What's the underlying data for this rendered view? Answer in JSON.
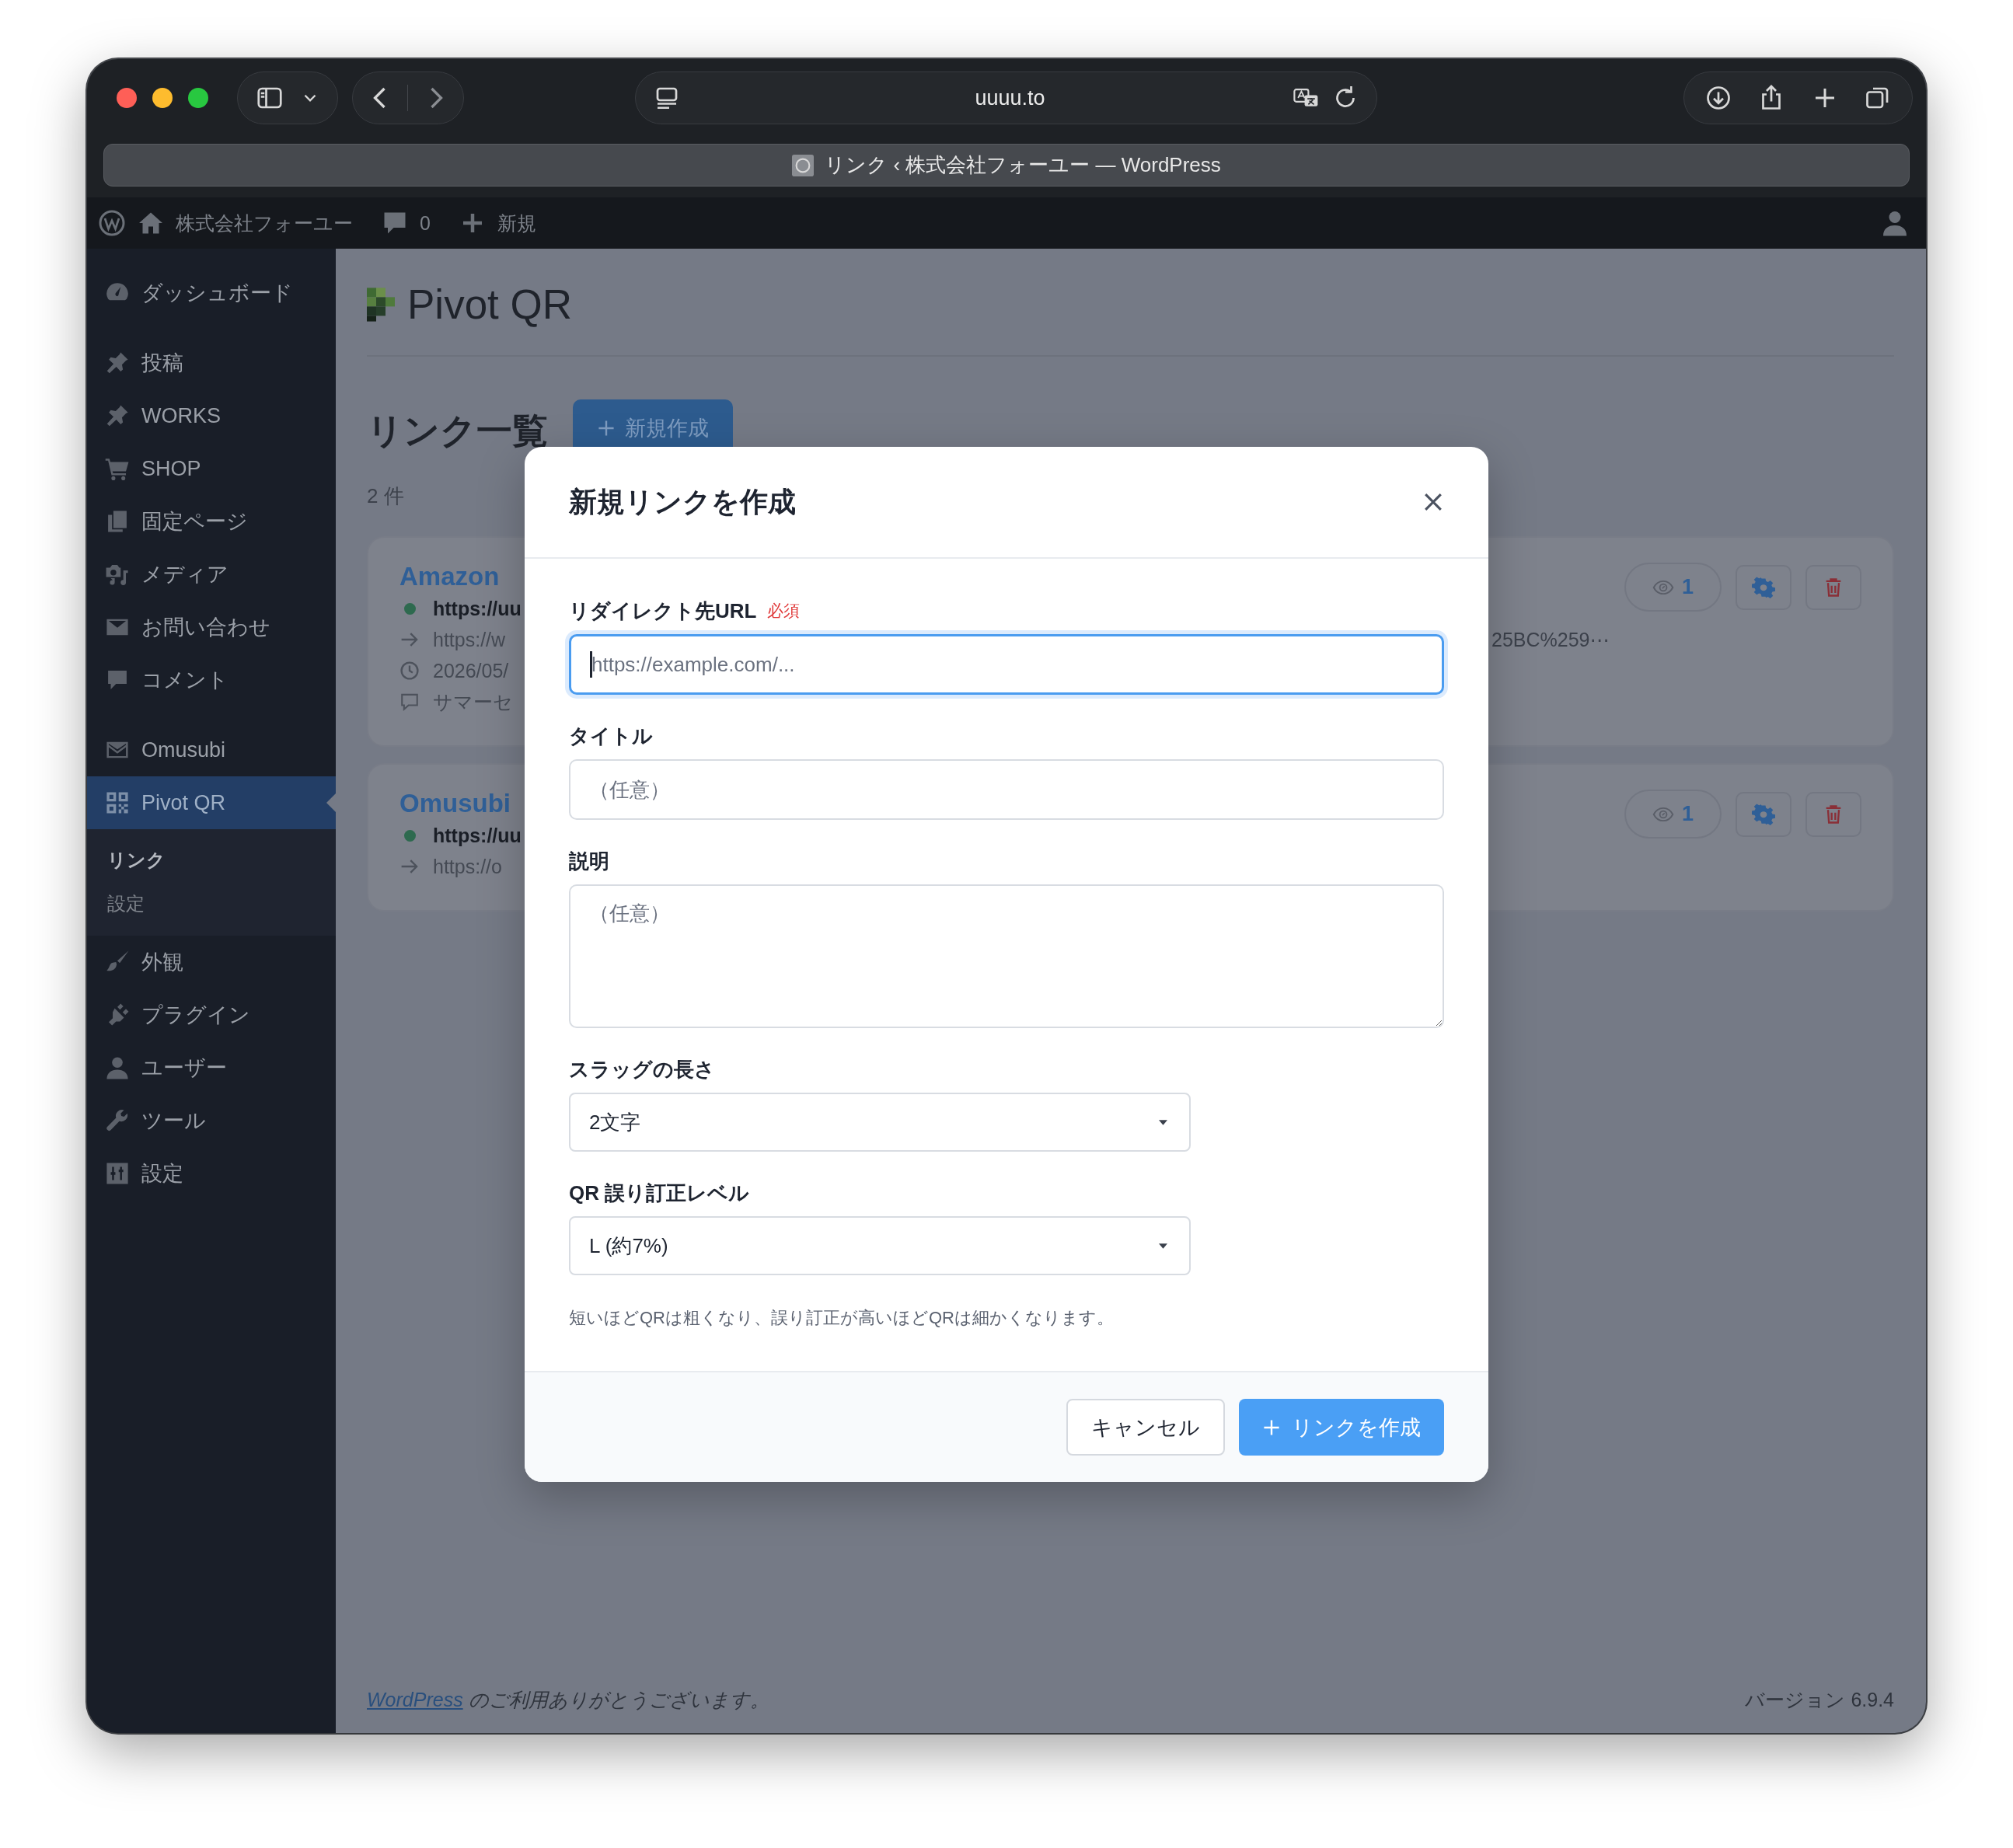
{
  "browser": {
    "address": "uuuu.to",
    "tab_title": "リンク ‹ 株式会社フォーユー — WordPress"
  },
  "admin_bar": {
    "site_name": "株式会社フォーユー",
    "comments": "0",
    "new": "新規"
  },
  "sidebar": {
    "groups": [
      [
        {
          "label": "ダッシュボード",
          "selected": false
        }
      ],
      [
        {
          "label": "投稿",
          "selected": false
        },
        {
          "label": "WORKS",
          "selected": false
        },
        {
          "label": "SHOP",
          "selected": false
        },
        {
          "label": "固定ページ",
          "selected": false
        },
        {
          "label": "メディア",
          "selected": false
        },
        {
          "label": "お問い合わせ",
          "selected": false
        },
        {
          "label": "コメント",
          "selected": false
        }
      ],
      [
        {
          "label": "Omusubi",
          "selected": false
        },
        {
          "label": "Pivot QR",
          "selected": true,
          "children": [
            {
              "label": "リンク",
              "selected": true
            },
            {
              "label": "設定",
              "selected": false
            }
          ]
        },
        {
          "label": "外観",
          "selected": false
        },
        {
          "label": "プラグイン",
          "selected": false
        },
        {
          "label": "ユーザー",
          "selected": false
        },
        {
          "label": "ツール",
          "selected": false
        },
        {
          "label": "設定",
          "selected": false
        }
      ]
    ]
  },
  "page": {
    "logo": "Pivot QR",
    "heading": "リンク一覧",
    "new_button": "新規作成",
    "count": "2 件",
    "links": [
      {
        "title": "Amazon",
        "views": "1",
        "lines": [
          {
            "kind": "short_url",
            "text": "https://uu",
            "active": true
          },
          {
            "kind": "destination",
            "text": "https://w",
            "tail": "25BC%259⋯"
          },
          {
            "kind": "date",
            "text": "2026/05/"
          },
          {
            "kind": "note",
            "text": "サマーセ"
          }
        ]
      },
      {
        "title": "Omusubi",
        "views": "1",
        "lines": [
          {
            "kind": "short_url",
            "text": "https://uu",
            "active": true
          },
          {
            "kind": "destination",
            "text": "https://o"
          }
        ]
      }
    ]
  },
  "modal": {
    "title": "新規リンクを作成",
    "fields": [
      {
        "kind": "text",
        "label": "リダイレクト先URL",
        "required_badge": "必須",
        "placeholder": "https://example.com/...",
        "focused": true
      },
      {
        "kind": "text",
        "label": "タイトル",
        "placeholder": "（任意）",
        "focused": false
      },
      {
        "kind": "textarea",
        "label": "説明",
        "placeholder": "（任意）",
        "focused": false
      },
      {
        "kind": "select",
        "label": "スラッグの長さ",
        "value": "2文字",
        "focused": false
      },
      {
        "kind": "select",
        "label": "QR 誤り訂正レベル",
        "value": "L (約7%)",
        "focused": false
      }
    ],
    "help": "短いほどQRは粗くなり、誤り訂正が高いほどQRは細かくなります。",
    "buttons": [
      {
        "kind": "secondary",
        "label": "キャンセル"
      },
      {
        "kind": "primary",
        "label": "リンクを作成"
      }
    ]
  },
  "footer": {
    "thanks_link": "WordPress",
    "thanks": " のご利用ありがとうございます。",
    "version": "バージョン 6.9.4"
  }
}
